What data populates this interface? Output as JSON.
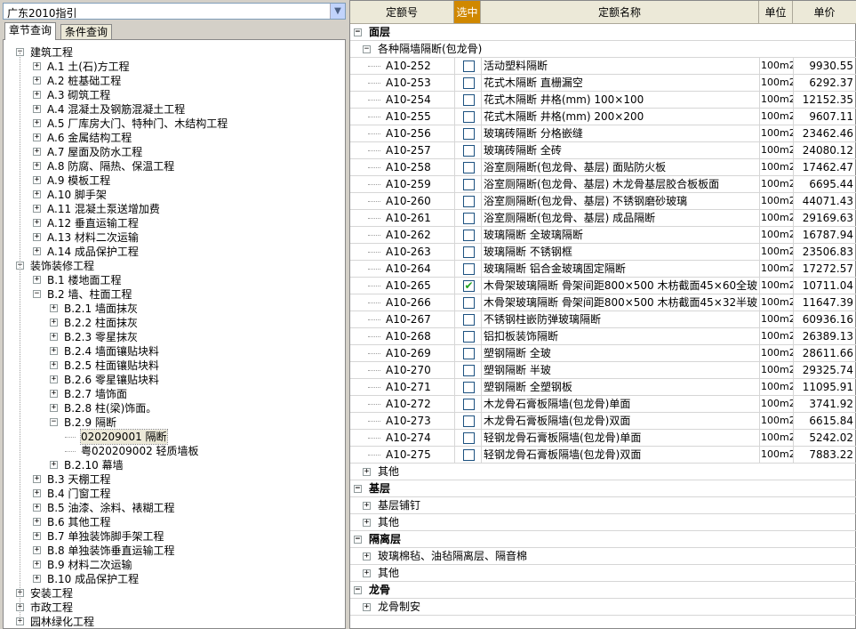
{
  "left": {
    "combo_value": "广东2010指引",
    "tabs": [
      "章节查询",
      "条件查询"
    ],
    "tree": [
      {
        "level": 0,
        "state": "-",
        "label": "建筑工程"
      },
      {
        "level": 1,
        "state": "+",
        "label": "A.1 土(石)方工程"
      },
      {
        "level": 1,
        "state": "+",
        "label": "A.2 桩基础工程"
      },
      {
        "level": 1,
        "state": "+",
        "label": "A.3 砌筑工程"
      },
      {
        "level": 1,
        "state": "+",
        "label": "A.4 混凝土及钢筋混凝土工程"
      },
      {
        "level": 1,
        "state": "+",
        "label": "A.5 厂库房大门、特种门、木结构工程"
      },
      {
        "level": 1,
        "state": "+",
        "label": "A.6 金属结构工程"
      },
      {
        "level": 1,
        "state": "+",
        "label": "A.7 屋面及防水工程"
      },
      {
        "level": 1,
        "state": "+",
        "label": "A.8 防腐、隔热、保温工程"
      },
      {
        "level": 1,
        "state": "+",
        "label": "A.9 模板工程"
      },
      {
        "level": 1,
        "state": "+",
        "label": "A.10 脚手架"
      },
      {
        "level": 1,
        "state": "+",
        "label": "A.11 混凝土泵送增加费"
      },
      {
        "level": 1,
        "state": "+",
        "label": "A.12 垂直运输工程"
      },
      {
        "level": 1,
        "state": "+",
        "label": "A.13 材料二次运输"
      },
      {
        "level": 1,
        "state": "+",
        "label": "A.14 成品保护工程"
      },
      {
        "level": 0,
        "state": "-",
        "label": "装饰装修工程"
      },
      {
        "level": 1,
        "state": "+",
        "label": "B.1 楼地面工程"
      },
      {
        "level": 1,
        "state": "-",
        "label": "B.2 墙、柱面工程"
      },
      {
        "level": 2,
        "state": "+",
        "label": "B.2.1 墙面抹灰"
      },
      {
        "level": 2,
        "state": "+",
        "label": "B.2.2 柱面抹灰"
      },
      {
        "level": 2,
        "state": "+",
        "label": "B.2.3 零星抹灰"
      },
      {
        "level": 2,
        "state": "+",
        "label": "B.2.4 墙面镶贴块料"
      },
      {
        "level": 2,
        "state": "+",
        "label": "B.2.5 柱面镶贴块料"
      },
      {
        "level": 2,
        "state": "+",
        "label": "B.2.6 零星镶贴块料"
      },
      {
        "level": 2,
        "state": "+",
        "label": "B.2.7 墙饰面"
      },
      {
        "level": 2,
        "state": "+",
        "label": "B.2.8 柱(梁)饰面。"
      },
      {
        "level": 2,
        "state": "-",
        "label": "B.2.9 隔断"
      },
      {
        "level": 3,
        "state": "",
        "label": "020209001  隔断",
        "selected": true
      },
      {
        "level": 3,
        "state": "",
        "label": "粤020209002  轻质墙板"
      },
      {
        "level": 2,
        "state": "+",
        "label": "B.2.10 幕墙"
      },
      {
        "level": 1,
        "state": "+",
        "label": "B.3 天棚工程"
      },
      {
        "level": 1,
        "state": "+",
        "label": "B.4 门窗工程"
      },
      {
        "level": 1,
        "state": "+",
        "label": "B.5 油漆、涂料、裱糊工程"
      },
      {
        "level": 1,
        "state": "+",
        "label": "B.6 其他工程"
      },
      {
        "level": 1,
        "state": "+",
        "label": "B.7 单独装饰脚手架工程"
      },
      {
        "level": 1,
        "state": "+",
        "label": "B.8 单独装饰垂直运输工程"
      },
      {
        "level": 1,
        "state": "+",
        "label": "B.9 材料二次运输"
      },
      {
        "level": 1,
        "state": "+",
        "label": "B.10 成品保护工程"
      },
      {
        "level": 0,
        "state": "+",
        "label": "安装工程"
      },
      {
        "level": 0,
        "state": "+",
        "label": "市政工程"
      },
      {
        "level": 0,
        "state": "+",
        "label": "园林绿化工程"
      }
    ]
  },
  "grid": {
    "headers": {
      "code": "定额号",
      "select": "选中",
      "name": "定额名称",
      "unit": "单位",
      "price": "单价"
    },
    "rows": [
      {
        "type": "group",
        "state": "-",
        "label": "面层"
      },
      {
        "type": "sub",
        "state": "-",
        "label": "各种隔墙隔断(包龙骨)"
      },
      {
        "type": "item",
        "code": "A10-252",
        "checked": false,
        "name": "活动塑料隔断",
        "unit": "100m2",
        "price": "9930.55"
      },
      {
        "type": "item",
        "code": "A10-253",
        "checked": false,
        "name": "花式木隔断   直栅漏空",
        "unit": "100m2",
        "price": "6292.37"
      },
      {
        "type": "item",
        "code": "A10-254",
        "checked": false,
        "name": "花式木隔断   井格(mm) 100×100",
        "unit": "100m2",
        "price": "12152.35"
      },
      {
        "type": "item",
        "code": "A10-255",
        "checked": false,
        "name": "花式木隔断   井格(mm) 200×200",
        "unit": "100m2",
        "price": "9607.11"
      },
      {
        "type": "item",
        "code": "A10-256",
        "checked": false,
        "name": "玻璃砖隔断   分格嵌缝",
        "unit": "100m2",
        "price": "23462.46"
      },
      {
        "type": "item",
        "code": "A10-257",
        "checked": false,
        "name": "玻璃砖隔断   全砖",
        "unit": "100m2",
        "price": "24080.12"
      },
      {
        "type": "item",
        "code": "A10-258",
        "checked": false,
        "name": "浴室厕隔断(包龙骨、基层) 面贴防火板",
        "unit": "100m2",
        "price": "17462.47"
      },
      {
        "type": "item",
        "code": "A10-259",
        "checked": false,
        "name": "浴室厕隔断(包龙骨、基层) 木龙骨基层胶合板板面",
        "unit": "100m2",
        "price": "6695.44"
      },
      {
        "type": "item",
        "code": "A10-260",
        "checked": false,
        "name": "浴室厕隔断(包龙骨、基层) 不锈钢磨砂玻璃",
        "unit": "100m2",
        "price": "44071.43"
      },
      {
        "type": "item",
        "code": "A10-261",
        "checked": false,
        "name": "浴室厕隔断(包龙骨、基层) 成品隔断",
        "unit": "100m2",
        "price": "29169.63"
      },
      {
        "type": "item",
        "code": "A10-262",
        "checked": false,
        "name": "玻璃隔断 全玻璃隔断",
        "unit": "100m2",
        "price": "16787.94"
      },
      {
        "type": "item",
        "code": "A10-263",
        "checked": false,
        "name": "玻璃隔断 不锈钢框",
        "unit": "100m2",
        "price": "23506.83"
      },
      {
        "type": "item",
        "code": "A10-264",
        "checked": false,
        "name": "玻璃隔断 铝合金玻璃固定隔断",
        "unit": "100m2",
        "price": "17272.57"
      },
      {
        "type": "item",
        "code": "A10-265",
        "checked": true,
        "name": "木骨架玻璃隔断   骨架间距800×500 木枋截面45×60全玻",
        "unit": "100m2",
        "price": "10711.04"
      },
      {
        "type": "item",
        "code": "A10-266",
        "checked": false,
        "name": "木骨架玻璃隔断   骨架间距800×500 木枋截面45×32半玻",
        "unit": "100m2",
        "price": "11647.39"
      },
      {
        "type": "item",
        "code": "A10-267",
        "checked": false,
        "name": "不锈钢柱嵌防弹玻璃隔断",
        "unit": "100m2",
        "price": "60936.16"
      },
      {
        "type": "item",
        "code": "A10-268",
        "checked": false,
        "name": "铝扣板装饰隔断",
        "unit": "100m2",
        "price": "26389.13"
      },
      {
        "type": "item",
        "code": "A10-269",
        "checked": false,
        "name": "塑钢隔断 全玻",
        "unit": "100m2",
        "price": "28611.66"
      },
      {
        "type": "item",
        "code": "A10-270",
        "checked": false,
        "name": "塑钢隔断 半玻",
        "unit": "100m2",
        "price": "29325.74"
      },
      {
        "type": "item",
        "code": "A10-271",
        "checked": false,
        "name": "塑钢隔断 全塑钢板",
        "unit": "100m2",
        "price": "11095.91"
      },
      {
        "type": "item",
        "code": "A10-272",
        "checked": false,
        "name": "木龙骨石膏板隔墙(包龙骨)单面",
        "unit": "100m2",
        "price": "3741.92"
      },
      {
        "type": "item",
        "code": "A10-273",
        "checked": false,
        "name": "木龙骨石膏板隔墙(包龙骨)双面",
        "unit": "100m2",
        "price": "6615.84"
      },
      {
        "type": "item",
        "code": "A10-274",
        "checked": false,
        "name": "轻钢龙骨石膏板隔墙(包龙骨)单面",
        "unit": "100m2",
        "price": "5242.02"
      },
      {
        "type": "item",
        "code": "A10-275",
        "checked": false,
        "name": "轻钢龙骨石膏板隔墙(包龙骨)双面",
        "unit": "100m2",
        "price": "7883.22"
      },
      {
        "type": "sub",
        "state": "+",
        "label": "其他"
      },
      {
        "type": "group",
        "state": "-",
        "label": "基层"
      },
      {
        "type": "sub",
        "state": "+",
        "label": "基层铺钉"
      },
      {
        "type": "sub",
        "state": "+",
        "label": "其他"
      },
      {
        "type": "group",
        "state": "-",
        "label": "隔离层"
      },
      {
        "type": "sub",
        "state": "+",
        "label": "玻璃棉毡、油毡隔离层、隔音棉"
      },
      {
        "type": "sub",
        "state": "+",
        "label": "其他"
      },
      {
        "type": "group",
        "state": "-",
        "label": "龙骨"
      },
      {
        "type": "sub",
        "state": "+",
        "label": "龙骨制安"
      }
    ]
  }
}
